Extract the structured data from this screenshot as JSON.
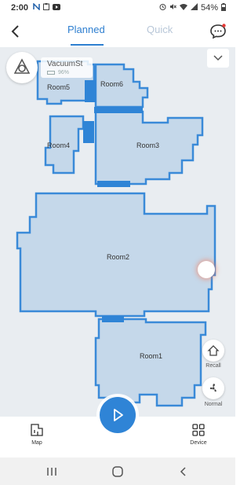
{
  "status_bar": {
    "time": "2:00",
    "battery": "54%",
    "left_icons": [
      "signal-n-icon",
      "clipboard-icon",
      "youtube-icon"
    ],
    "right_icons": [
      "alarm-icon",
      "mute-icon",
      "wifi-icon",
      "cell-signal-icon",
      "battery-icon"
    ]
  },
  "header": {
    "tabs": [
      {
        "label": "Planned",
        "active": true
      },
      {
        "label": "Quick",
        "active": false
      }
    ],
    "accent_color": "#2e7fd0"
  },
  "vacuum": {
    "name": "VacuumSt",
    "battery": "96%"
  },
  "map": {
    "rooms": [
      {
        "label": "Room5"
      },
      {
        "label": "Room6"
      },
      {
        "label": "Room4"
      },
      {
        "label": "Room3"
      },
      {
        "label": "Room2"
      },
      {
        "label": "Room1"
      }
    ],
    "room_fill": "#c5d8ea",
    "room_stroke": "#3a8ad8"
  },
  "side_buttons": {
    "recall_label": "Recall",
    "mode_label": "Normal"
  },
  "bottom_bar": {
    "map_label": "Map",
    "device_label": "Device"
  }
}
